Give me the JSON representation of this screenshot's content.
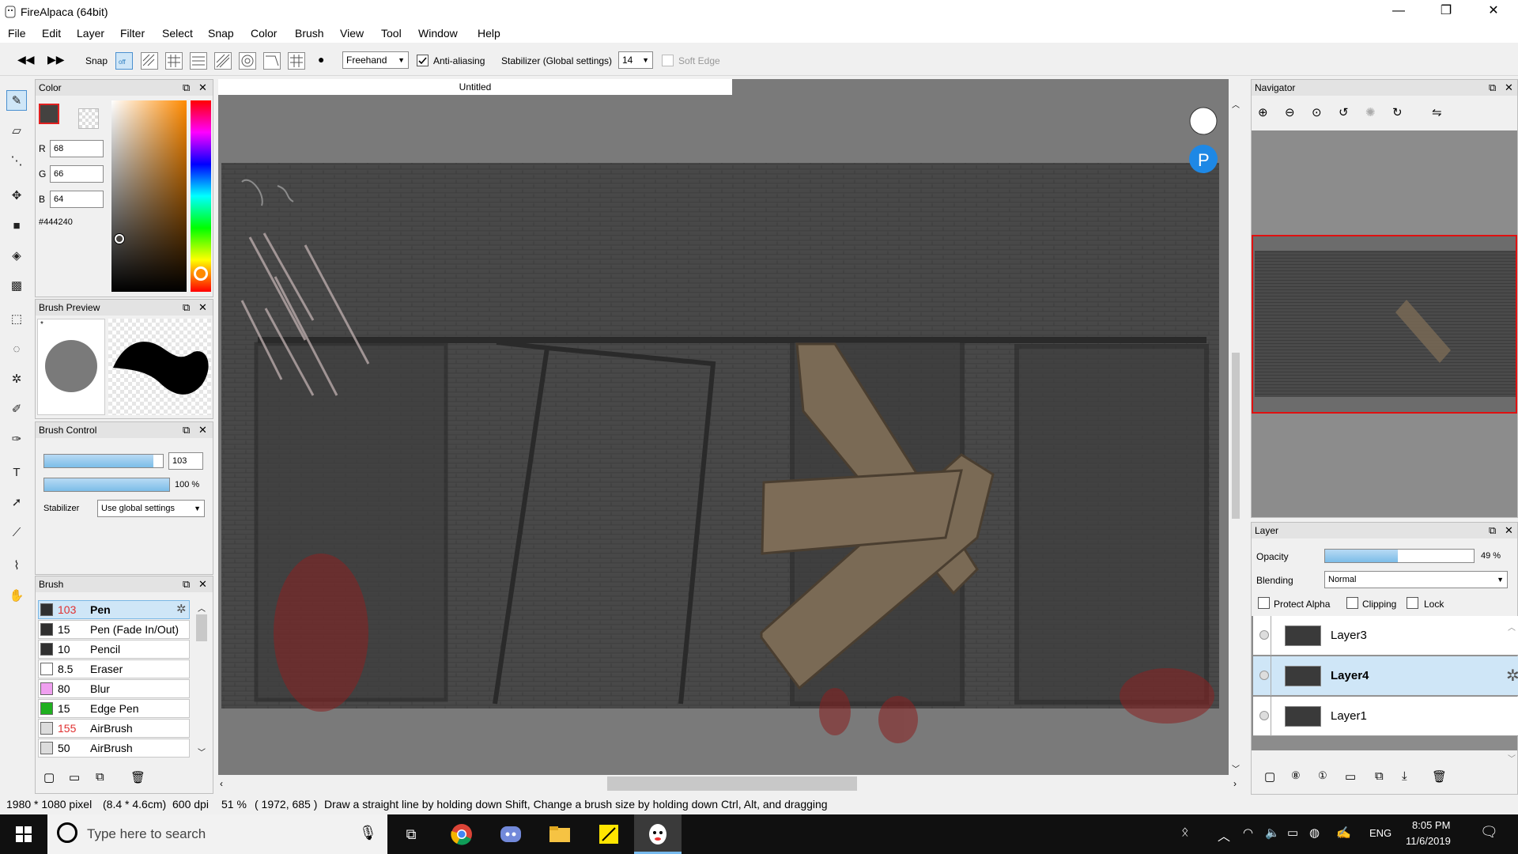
{
  "app": {
    "title": "FireAlpaca (64bit)"
  },
  "window_controls": {
    "minimize": "—",
    "restore": "❐",
    "close": "✕"
  },
  "menu": [
    "File",
    "Edit",
    "Layer",
    "Filter",
    "Select",
    "Snap",
    "Color",
    "Brush",
    "View",
    "Tool",
    "Window",
    "Help"
  ],
  "toolbar": {
    "snap_label": "Snap",
    "snap_off_label": "off",
    "mode_value": "Freehand",
    "antialias_label": "Anti-aliasing",
    "antialias_checked": true,
    "stabilizer_label": "Stabilizer (Global settings)",
    "stabilizer_value": "14",
    "soft_edge_label": "Soft Edge",
    "soft_edge_checked": false
  },
  "color_panel": {
    "title": "Color",
    "r_label": "R",
    "r_value": "68",
    "g_label": "G",
    "g_value": "66",
    "b_label": "B",
    "b_value": "64",
    "hex": "#444240",
    "primary_color": "#444240",
    "hue_color": "#ff8a00"
  },
  "brush_preview": {
    "title": "Brush Preview",
    "marker": "*"
  },
  "brush_control": {
    "title": "Brush Control",
    "size_value": "103",
    "size_fraction": 0.92,
    "opacity_value": "100 %",
    "opacity_fraction": 1.0,
    "stabilizer_label": "Stabilizer",
    "stabilizer_value": "Use global settings"
  },
  "brush_panel": {
    "title": "Brush",
    "brushes": [
      {
        "size": "103",
        "name": "Pen",
        "color": "#303030",
        "selected": true,
        "size_red": true
      },
      {
        "size": "15",
        "name": "Pen (Fade In/Out)",
        "color": "#303030",
        "selected": false,
        "size_red": false
      },
      {
        "size": "10",
        "name": "Pencil",
        "color": "#303030",
        "selected": false,
        "size_red": false
      },
      {
        "size": "8.5",
        "name": "Eraser",
        "color": "#ffffff",
        "selected": false,
        "size_red": false
      },
      {
        "size": "80",
        "name": "Blur",
        "color": "#f0a0f0",
        "selected": false,
        "size_red": false
      },
      {
        "size": "15",
        "name": "Edge Pen",
        "color": "#20b020",
        "selected": false,
        "size_red": false
      },
      {
        "size": "155",
        "name": "AirBrush",
        "color": "#dcdcdc",
        "selected": false,
        "size_red": true
      },
      {
        "size": "50",
        "name": "AirBrush",
        "color": "#dcdcdc",
        "selected": false,
        "size_red": false
      }
    ]
  },
  "canvas": {
    "tab_title": "Untitled"
  },
  "navigator": {
    "title": "Navigator"
  },
  "layer_panel": {
    "title": "Layer",
    "opacity_label": "Opacity",
    "opacity_value": "49 %",
    "opacity_fraction": 0.49,
    "blending_label": "Blending",
    "blending_value": "Normal",
    "protect_alpha_label": "Protect Alpha",
    "clipping_label": "Clipping",
    "lock_label": "Lock",
    "layers": [
      {
        "name": "Layer3",
        "selected": false
      },
      {
        "name": "Layer4",
        "selected": true
      },
      {
        "name": "Layer1",
        "selected": false
      }
    ]
  },
  "status": {
    "image_size": "1980 * 1080 pixel",
    "physical_size": "(8.4 * 4.6cm)",
    "dpi": "600 dpi",
    "zoom": "51 %",
    "cursor": "( 1972, 685 )",
    "hint": "Draw a straight line by holding down Shift, Change a brush size by holding down Ctrl, Alt, and dragging"
  },
  "taskbar": {
    "search_placeholder": "Type here to search",
    "language": "ENG",
    "time": "8:05 PM",
    "date": "11/6/2019"
  }
}
